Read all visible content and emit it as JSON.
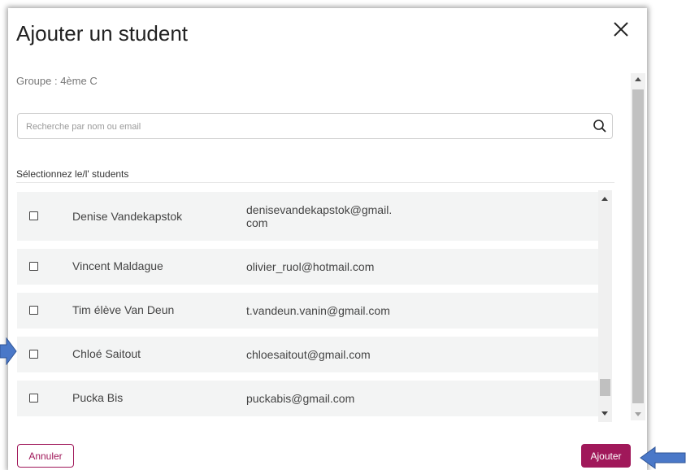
{
  "dialog": {
    "title": "Ajouter un student",
    "group_label": "Groupe : 4ème C"
  },
  "search": {
    "placeholder": "Recherche par nom ou email",
    "value": ""
  },
  "list": {
    "heading": "Sélectionnez le/l' students",
    "students": [
      {
        "name": "Denise Vandekapstok",
        "email_line1": "denisevandekapstok@gmail.",
        "email_line2": "com",
        "checked": false
      },
      {
        "name": "Vincent Maldague",
        "email_line1": "olivier_ruol@hotmail.com",
        "email_line2": "",
        "checked": false
      },
      {
        "name": "Tim élève Van Deun",
        "email_line1": "t.vandeun.vanin@gmail.com",
        "email_line2": "",
        "checked": false
      },
      {
        "name": "Chloé Saitout",
        "email_line1": "chloesaitout@gmail.com",
        "email_line2": "",
        "checked": false
      },
      {
        "name": "Pucka Bis",
        "email_line1": "puckabis@gmail.com",
        "email_line2": "",
        "checked": false
      }
    ]
  },
  "footer": {
    "cancel_label": "Annuler",
    "add_label": "Ajouter"
  },
  "icons": {
    "close": "close-icon",
    "search": "search-icon",
    "annotation_arrow": "arrow-right-icon"
  },
  "colors": {
    "accent": "#a0185a",
    "annotation_arrow": "#4a78c8",
    "row_background": "#f3f4f4"
  }
}
